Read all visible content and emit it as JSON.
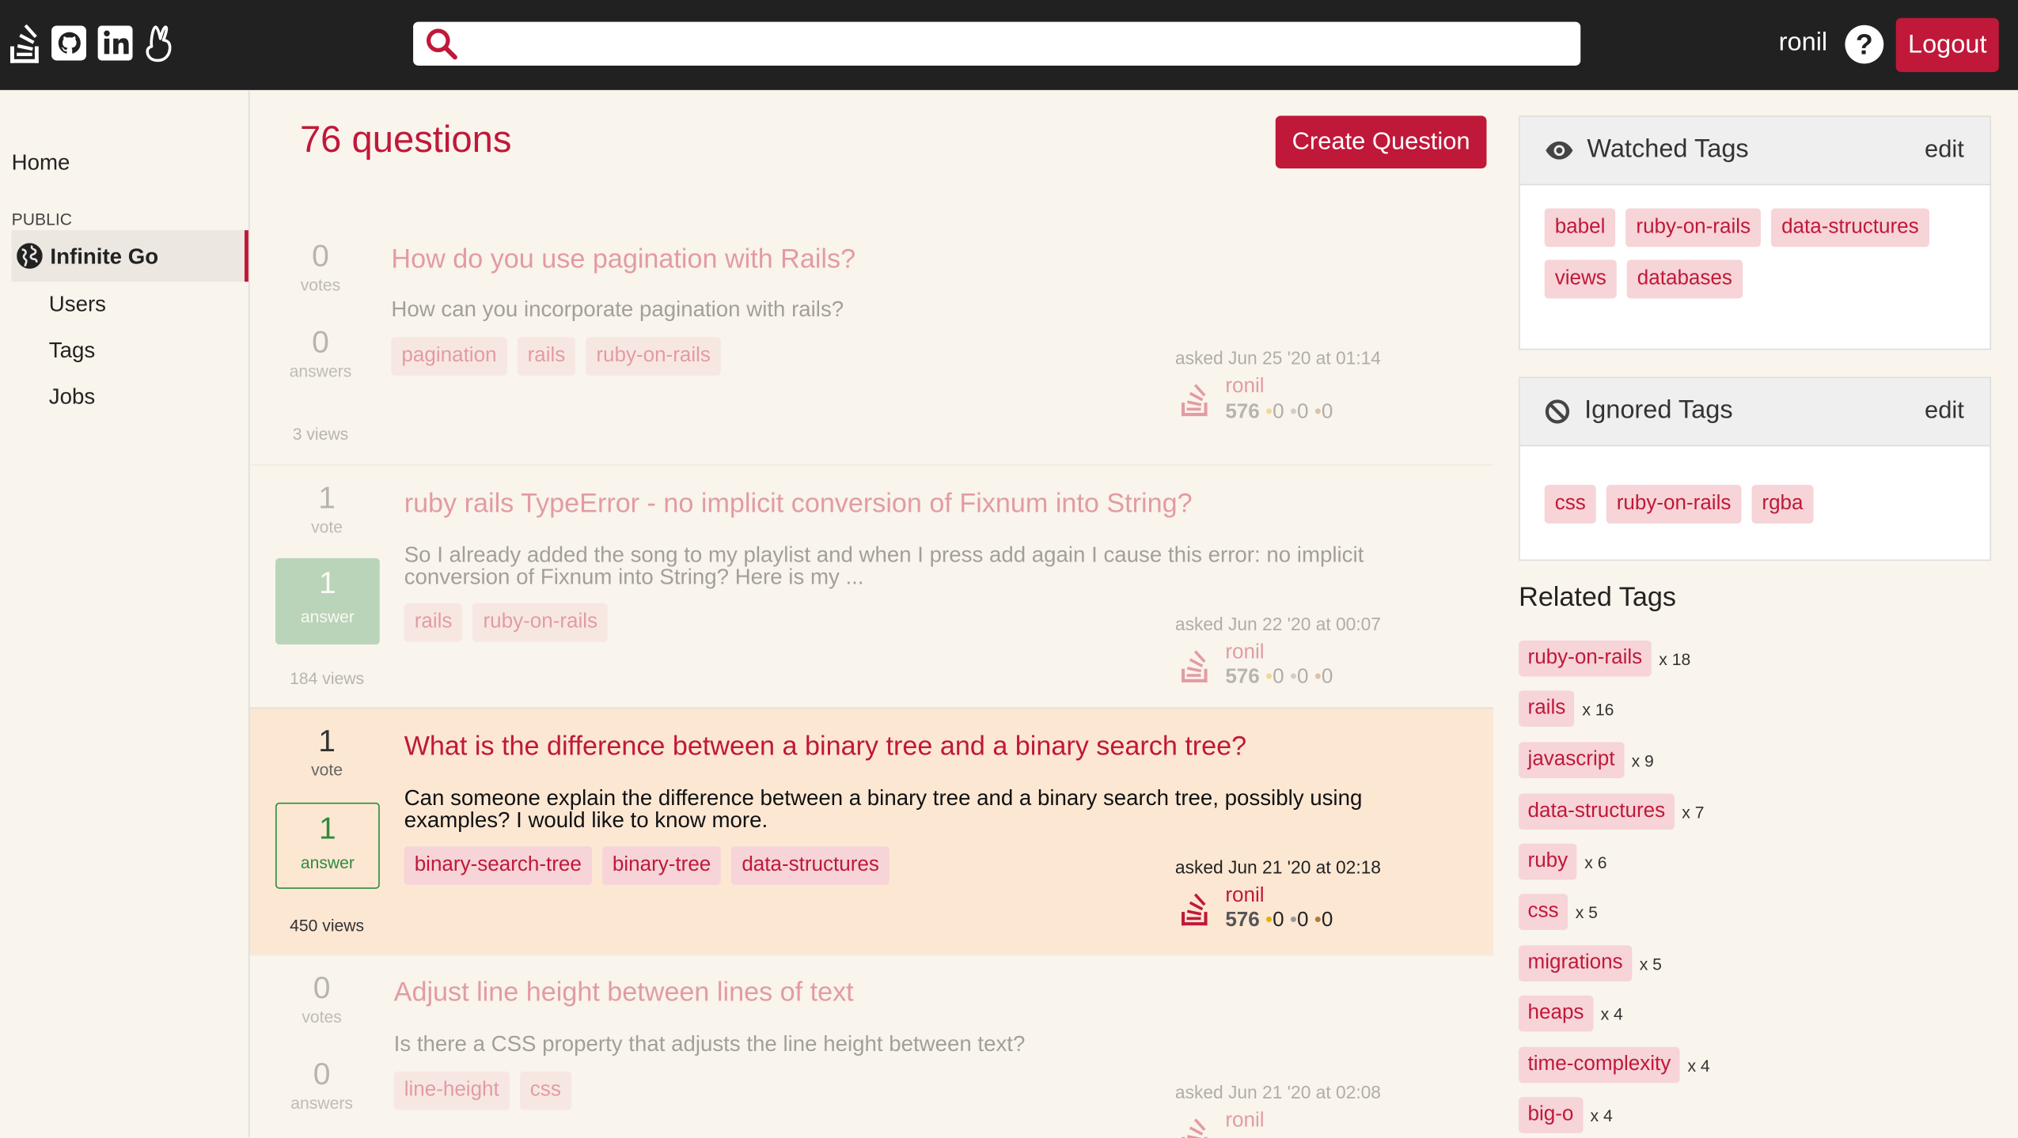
{
  "header": {
    "search_placeholder": "",
    "username": "ronil",
    "logout_label": "Logout"
  },
  "sidebar": {
    "home": "Home",
    "section": "PUBLIC",
    "active": "Infinite Go",
    "items": [
      "Users",
      "Tags",
      "Jobs"
    ]
  },
  "main": {
    "title": "76 questions",
    "create_label": "Create Question"
  },
  "questions": [
    {
      "votes": "0",
      "votes_label": "votes",
      "answers": "0",
      "answers_label": "answers",
      "views": "3 views",
      "title": "How do you use pagination with Rails?",
      "excerpt": "How can you incorporate pagination with rails?",
      "tags": [
        "pagination",
        "rails",
        "ruby-on-rails"
      ],
      "asked": "asked Jun 25 '20 at 01:14",
      "user": "ronil",
      "rep": "576",
      "gold": "0",
      "silver": "0",
      "bronze": "0"
    },
    {
      "votes": "1",
      "votes_label": "vote",
      "answers": "1",
      "answers_label": "answer",
      "views": "184 views",
      "title": "ruby rails TypeError - no implicit conversion of Fixnum into String?",
      "excerpt": "So I already added the song to my playlist and when I press add again I cause this error: no implicit conversion of Fixnum into String? Here is my ...",
      "tags": [
        "rails",
        "ruby-on-rails"
      ],
      "asked": "asked Jun 22 '20 at 00:07",
      "user": "ronil",
      "rep": "576",
      "gold": "0",
      "silver": "0",
      "bronze": "0"
    },
    {
      "votes": "1",
      "votes_label": "vote",
      "answers": "1",
      "answers_label": "answer",
      "views": "450 views",
      "title": "What is the difference between a binary tree and a binary search tree?",
      "excerpt": "Can someone explain the difference between a binary tree and a binary search tree, possibly using examples? I would like to know more.",
      "tags": [
        "binary-search-tree",
        "binary-tree",
        "data-structures"
      ],
      "asked": "asked Jun 21 '20 at 02:18",
      "user": "ronil",
      "rep": "576",
      "gold": "0",
      "silver": "0",
      "bronze": "0"
    },
    {
      "votes": "0",
      "votes_label": "votes",
      "answers": "0",
      "answers_label": "answers",
      "title": "Adjust line height between lines of text",
      "excerpt": "Is there a CSS property that adjusts the line height between text?",
      "tags": [
        "line-height",
        "css"
      ],
      "asked": "asked Jun 21 '20 at 02:08",
      "user": "ronil"
    }
  ],
  "watched": {
    "title": "Watched Tags",
    "edit": "edit",
    "tags": [
      "babel",
      "ruby-on-rails",
      "data-structures",
      "views",
      "databases"
    ]
  },
  "ignored": {
    "title": "Ignored Tags",
    "edit": "edit",
    "tags": [
      "css",
      "ruby-on-rails",
      "rgba"
    ]
  },
  "related": {
    "title": "Related Tags",
    "items": [
      {
        "tag": "ruby-on-rails",
        "count": "x 18"
      },
      {
        "tag": "rails",
        "count": "x 16"
      },
      {
        "tag": "javascript",
        "count": "x 9"
      },
      {
        "tag": "data-structures",
        "count": "x 7"
      },
      {
        "tag": "ruby",
        "count": "x 6"
      },
      {
        "tag": "css",
        "count": "x 5"
      },
      {
        "tag": "migrations",
        "count": "x 5"
      },
      {
        "tag": "heaps",
        "count": "x 4"
      },
      {
        "tag": "time-complexity",
        "count": "x 4"
      },
      {
        "tag": "big-o",
        "count": "x 4"
      }
    ]
  },
  "colors": {
    "accent": "#c01839",
    "header_bg": "#212121",
    "tag_bg": "#f6d4d8",
    "answered": "#2e8b3e",
    "highlight_row": "#fce7d3"
  },
  "icons": [
    "stack-overflow-icon",
    "github-icon",
    "linkedin-icon",
    "angellist-icon",
    "search-icon",
    "help-icon",
    "globe-icon",
    "eye-icon",
    "ban-icon"
  ]
}
